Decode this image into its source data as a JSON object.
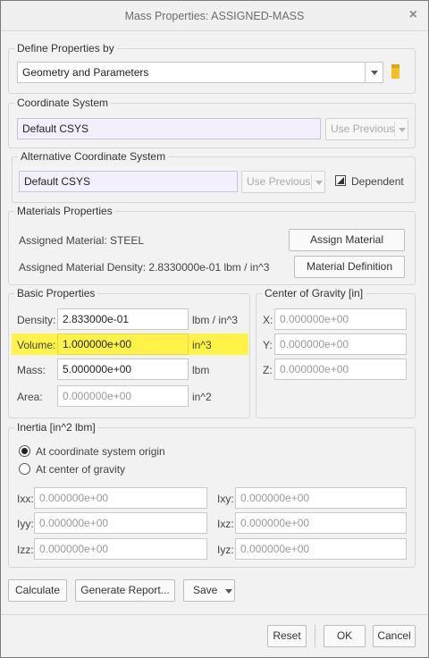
{
  "window": {
    "title": "Mass Properties: ASSIGNED-MASS",
    "close_glyph": "×"
  },
  "define_properties": {
    "legend": "Define Properties by",
    "value": "Geometry and Parameters"
  },
  "coordinate_system": {
    "legend": "Coordinate System",
    "value": "Default CSYS",
    "use_previous": "Use Previous"
  },
  "alt_coordinate_system": {
    "legend": "Alternative Coordinate System",
    "value": "Default CSYS",
    "use_previous": "Use Previous",
    "dependent_label": "Dependent",
    "dependent_checked": true
  },
  "materials": {
    "legend": "Materials Properties",
    "assigned_material": "Assigned Material:  STEEL",
    "density_text": "Assigned Material Density:  2.8330000e-01  lbm / in^3",
    "assign_button": "Assign Material",
    "definition_button": "Material Definition"
  },
  "basic": {
    "legend": "Basic Properties",
    "rows": [
      {
        "label": "Density:",
        "value": "2.833000e-01",
        "unit": "lbm / in^3"
      },
      {
        "label": "Volume:",
        "value": "1.000000e+00",
        "unit": "in^3"
      },
      {
        "label": "Mass:",
        "value": "5.000000e+00",
        "unit": "lbm"
      },
      {
        "label": "Area:",
        "value": "0.000000e+00",
        "unit": "in^2"
      }
    ]
  },
  "center_of_gravity": {
    "legend": "Center of Gravity [in]",
    "rows": [
      {
        "label": "X:",
        "value": "0.000000e+00"
      },
      {
        "label": "Y:",
        "value": "0.000000e+00"
      },
      {
        "label": "Z:",
        "value": "0.000000e+00"
      }
    ]
  },
  "inertia": {
    "legend": "Inertia [in^2 lbm]",
    "option_origin": "At coordinate system origin",
    "option_cog": "At center of gravity",
    "selected": "origin",
    "cells": [
      {
        "label": "Ixx:",
        "value": "0.000000e+00"
      },
      {
        "label": "Ixy:",
        "value": "0.000000e+00"
      },
      {
        "label": "Iyy:",
        "value": "0.000000e+00"
      },
      {
        "label": "Ixz:",
        "value": "0.000000e+00"
      },
      {
        "label": "Izz:",
        "value": "0.000000e+00"
      },
      {
        "label": "Iyz:",
        "value": "0.000000e+00"
      }
    ]
  },
  "actions": {
    "calculate": "Calculate",
    "generate_report": "Generate Report...",
    "save": "Save"
  },
  "footer": {
    "reset": "Reset",
    "ok": "OK",
    "cancel": "Cancel"
  },
  "colors": {
    "highlight": "#fff22e",
    "folder_icon": "#f3c21d",
    "field_lavender": "#f3f0fb"
  }
}
